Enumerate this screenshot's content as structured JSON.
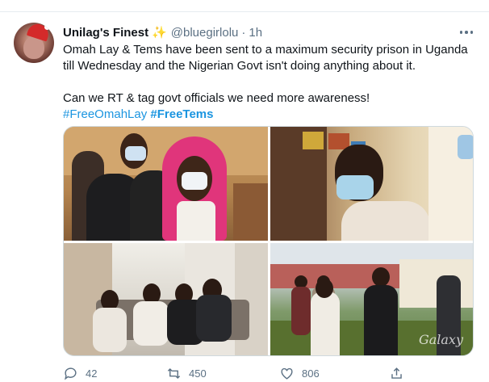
{
  "tweet": {
    "display_name": "Unilag's Finest",
    "badge_icon": "sparkles-icon",
    "handle": "@bluegirlolu",
    "separator": "·",
    "time": "1h",
    "text_line1": "Omah Lay & Tems have been sent to a maximum security prison in Uganda till Wednesday and the Nigerian Govt isn't doing anything about it.",
    "text_line2": "Can we RT & tag govt officials we need more awareness!",
    "hashtags": [
      "#FreeOmahLay",
      "#FreeTems"
    ],
    "hashtag_color": "#1b95e0"
  },
  "media": {
    "watermark": "Galaxy"
  },
  "actions": {
    "reply_count": "42",
    "retweet_count": "450",
    "like_count": "806",
    "share_icon": "share-icon"
  }
}
